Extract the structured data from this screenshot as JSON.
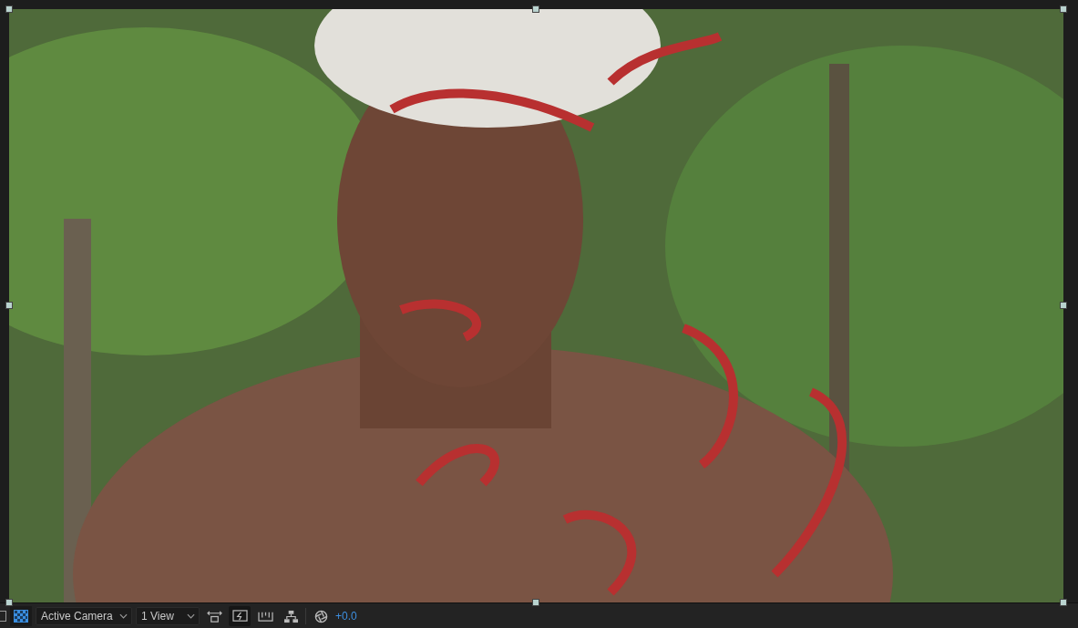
{
  "toolbar": {
    "transparency_grid": {
      "on": true
    },
    "camera": "Active Camera",
    "views": "1 View",
    "fast_previews": {
      "on": true
    },
    "exposure": "+0.0"
  }
}
